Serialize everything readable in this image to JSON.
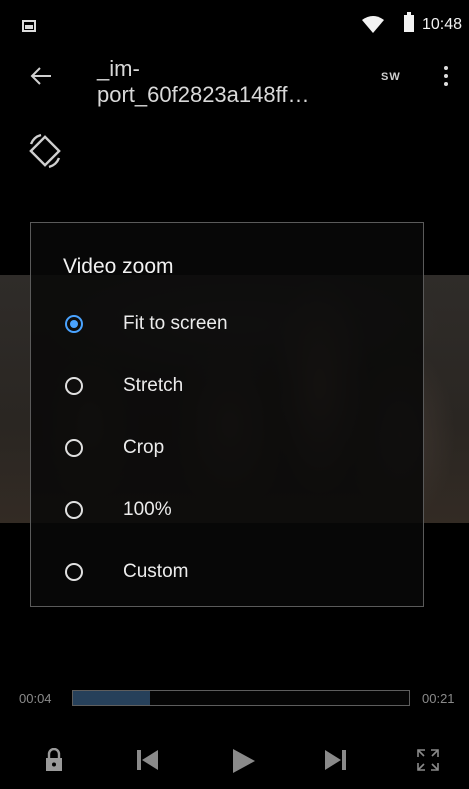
{
  "status_bar": {
    "time": "10:48",
    "icons": [
      "image-notification-icon",
      "wifi-icon",
      "battery-icon"
    ]
  },
  "toolbar": {
    "back_icon": "arrow-left-icon",
    "title": "_im-\nport_60f2823a148ff…",
    "subtitle_badge": "SW",
    "more_icon": "more-vertical-icon"
  },
  "rotate_icon": "screen-rotation-icon",
  "zoom_dialog": {
    "title": "Video zoom",
    "options": [
      {
        "label": "Fit to screen",
        "selected": true
      },
      {
        "label": "Stretch",
        "selected": false
      },
      {
        "label": "Crop",
        "selected": false
      },
      {
        "label": "100%",
        "selected": false
      },
      {
        "label": "Custom",
        "selected": false
      }
    ]
  },
  "playback": {
    "current_time": "00:04",
    "total_time": "00:21",
    "progress_fraction": 0.23
  },
  "controls": {
    "icons": [
      "lock-icon",
      "skip-previous-icon",
      "play-icon",
      "skip-next-icon",
      "fullscreen-icon"
    ]
  },
  "colors": {
    "accent": "#4aa3ff",
    "progress_fill": "#26405a"
  }
}
